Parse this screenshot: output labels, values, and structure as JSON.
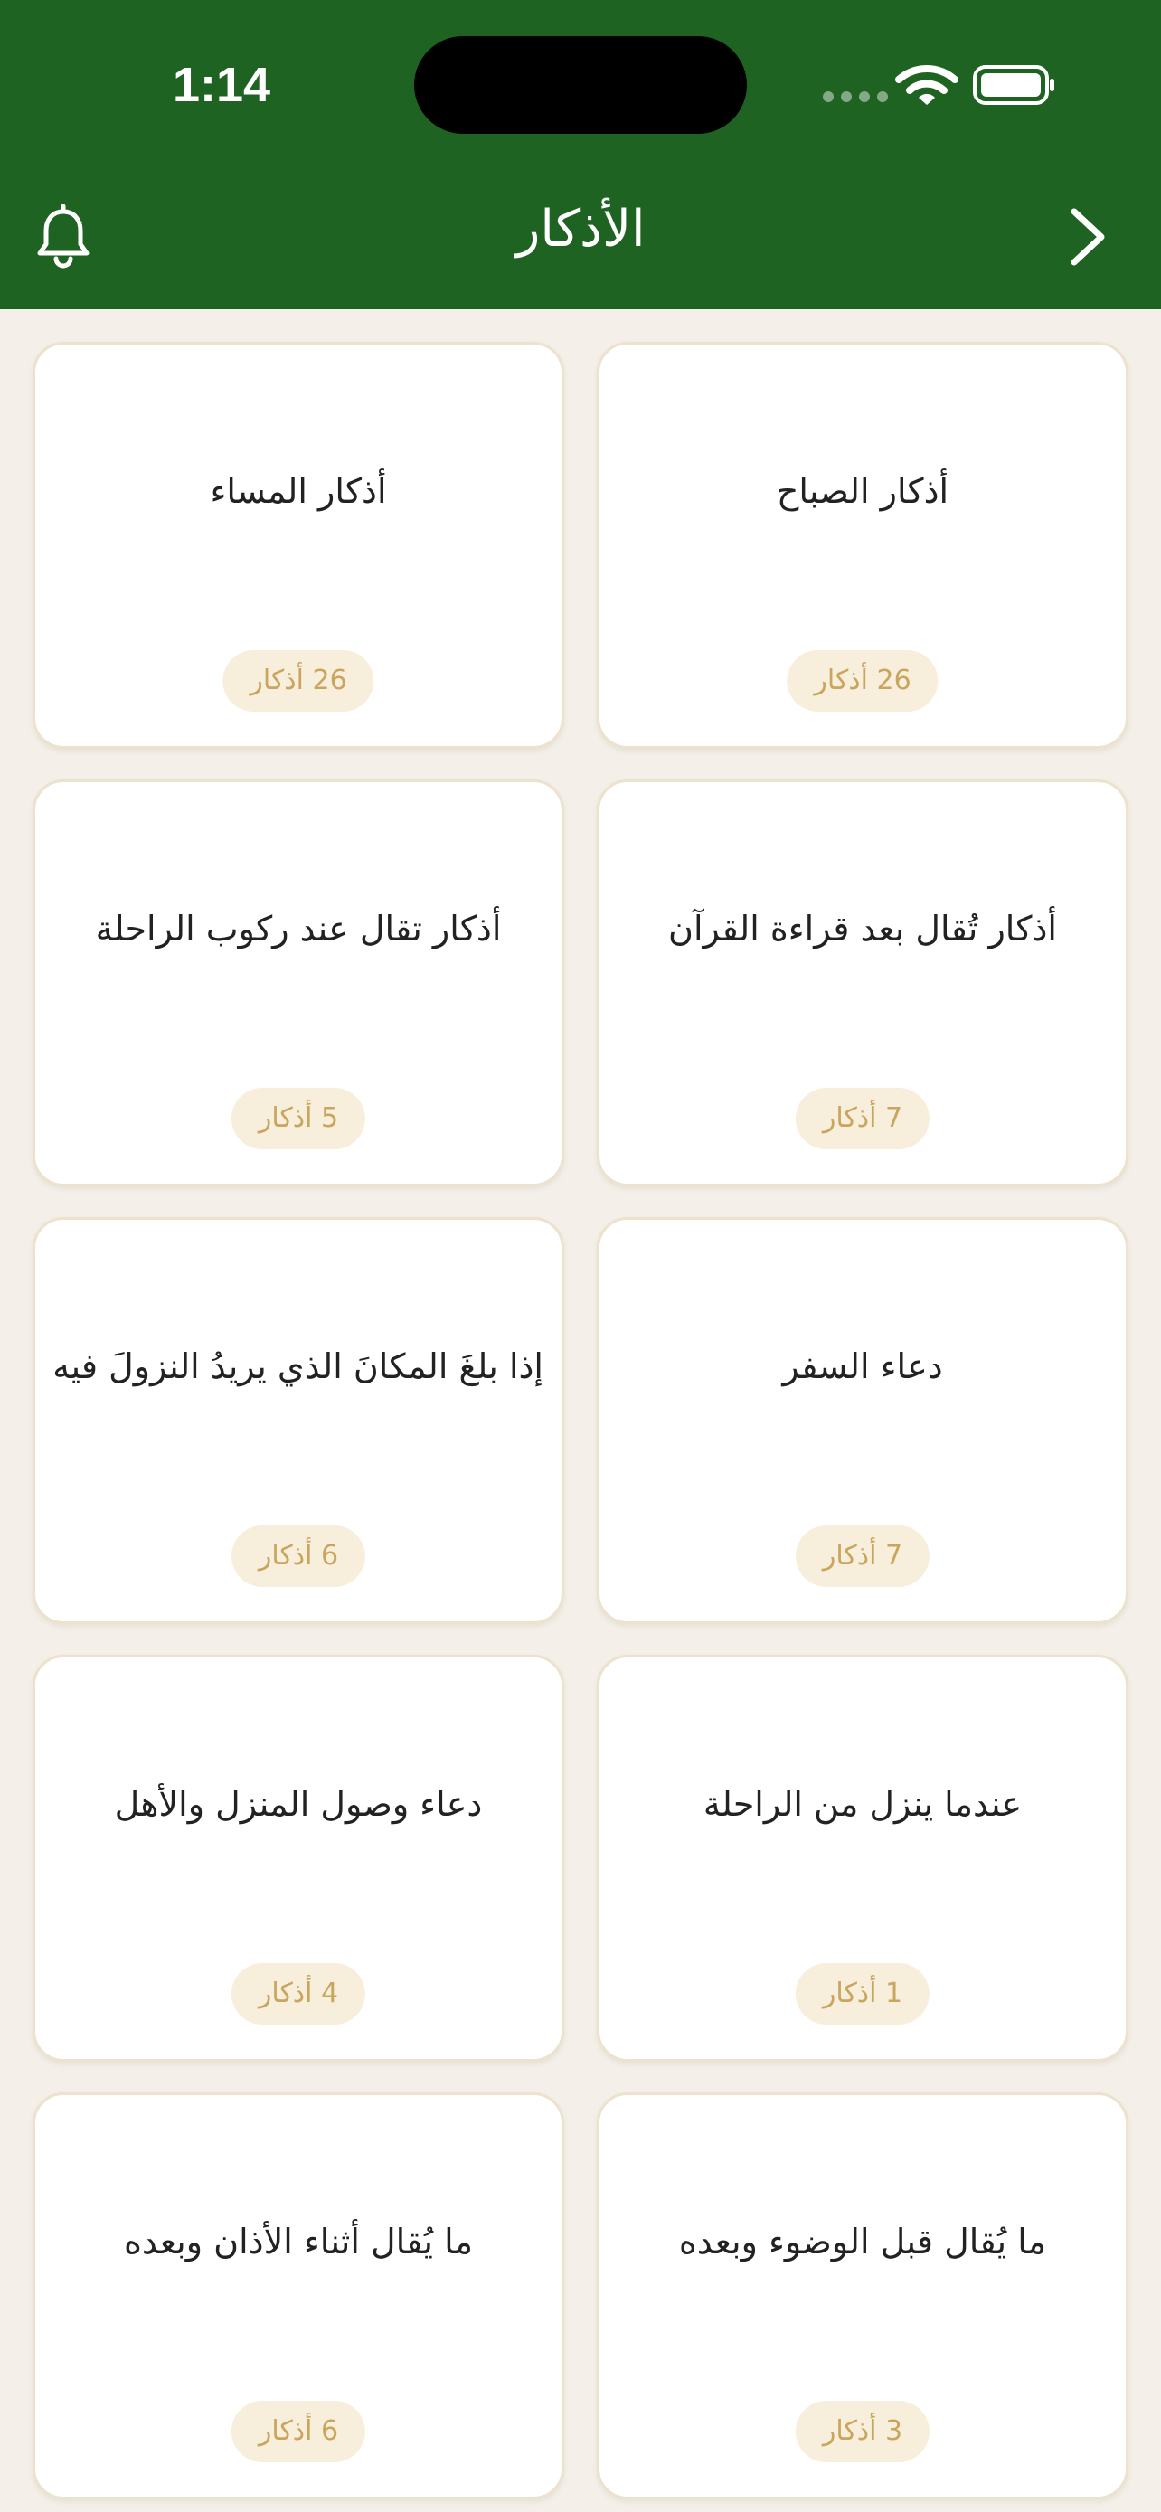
{
  "status_bar": {
    "time": "1:14"
  },
  "nav": {
    "title": "الأذكار",
    "left_icon": "bell-icon",
    "right_icon": "chevron-right-icon"
  },
  "colors": {
    "header": "#1f6322",
    "background": "#f4f0e9",
    "badge_bg": "#f7efdc",
    "badge_text": "#c9a55d"
  },
  "cards": [
    {
      "title": "أذكار الصباح",
      "count": "26 أذكار"
    },
    {
      "title": "أذكار المساء",
      "count": "26 أذكار"
    },
    {
      "title": "أذكار تُقال بعد قراءة القرآن",
      "count": "7 أذكار"
    },
    {
      "title": "أذكار تقال عند ركوب الراحلة",
      "count": "5 أذكار"
    },
    {
      "title": "دعاء السفر",
      "count": "7 أذكار"
    },
    {
      "title": "إذا بلغَ المكانَ الذي يريدُ النزولَ فيه",
      "count": "6 أذكار"
    },
    {
      "title": "عندما ينزل من الراحلة",
      "count": "1 أذكار"
    },
    {
      "title": "دعاء وصول المنزل والأهل",
      "count": "4 أذكار"
    },
    {
      "title": "ما يُقال قبل الوضوء وبعده",
      "count": "3 أذكار"
    },
    {
      "title": "ما يُقال أثناء الأذان وبعده",
      "count": "6 أذكار"
    }
  ]
}
